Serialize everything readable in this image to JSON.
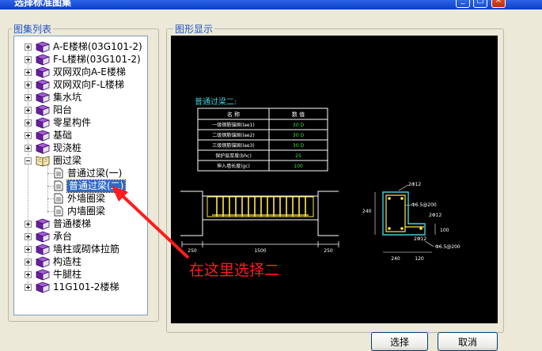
{
  "window": {
    "title": "选择标准图集"
  },
  "left_panel": {
    "label": "图集列表"
  },
  "right_panel": {
    "label": "图形显示"
  },
  "tree": {
    "items": [
      {
        "label": "A-E楼梯(03G101-2)",
        "expanded": false
      },
      {
        "label": "F-L楼梯(03G101-2)",
        "expanded": false
      },
      {
        "label": "双网双向A-E楼梯",
        "expanded": false
      },
      {
        "label": "双网双向F-L楼梯",
        "expanded": false
      },
      {
        "label": "集水坑",
        "expanded": false
      },
      {
        "label": "阳台",
        "expanded": false
      },
      {
        "label": "零星构件",
        "expanded": false
      },
      {
        "label": "基础",
        "expanded": false
      },
      {
        "label": "现浇桩",
        "expanded": false
      },
      {
        "label": "圈过梁",
        "expanded": true,
        "children": [
          {
            "label": "普通过梁(一)",
            "selected": false
          },
          {
            "label": "普通过梁(二)",
            "selected": true
          },
          {
            "label": "外墙圈梁",
            "selected": false
          },
          {
            "label": "内墙圈梁",
            "selected": false
          }
        ]
      },
      {
        "label": "普通楼梯",
        "expanded": false
      },
      {
        "label": "承台",
        "expanded": false
      },
      {
        "label": "墙柱或砌体拉筋",
        "expanded": false
      },
      {
        "label": "构造柱",
        "expanded": false
      },
      {
        "label": "牛腿柱",
        "expanded": false
      },
      {
        "label": "11G101-2楼梯",
        "expanded": false
      }
    ]
  },
  "drawing": {
    "title": "普通过梁二:",
    "table": {
      "headers": [
        "名 称",
        "数 值"
      ],
      "rows": [
        [
          "一级钢筋锚固(lae1)",
          "30 D"
        ],
        [
          "二级钢筋锚固(lae2)",
          "30 D"
        ],
        [
          "三级钢筋锚固(lae3)",
          "30 D"
        ],
        [
          "保护层厚度(bhc)",
          "25"
        ],
        [
          "伸入墙长度(gc)",
          "100"
        ]
      ]
    },
    "elevation_dims": [
      "250",
      "1500",
      "250"
    ],
    "section": {
      "top_bar": "2Φ12",
      "stirrup_main": "Φ6.5@200",
      "right_bar": "2Φ12",
      "bottom_bar": "2Φ12",
      "stirrup_side": "Φ6.5@200",
      "height": "240",
      "side_height": "100",
      "width": "240",
      "ledge_width": "120"
    }
  },
  "annotation": {
    "text": "在这里选择二"
  },
  "buttons": {
    "select": "选择",
    "cancel": "取消"
  },
  "colors": {
    "selection": "#316ac5",
    "annotation": "#ff1c1c",
    "titlebar": "#0a3fc6"
  }
}
